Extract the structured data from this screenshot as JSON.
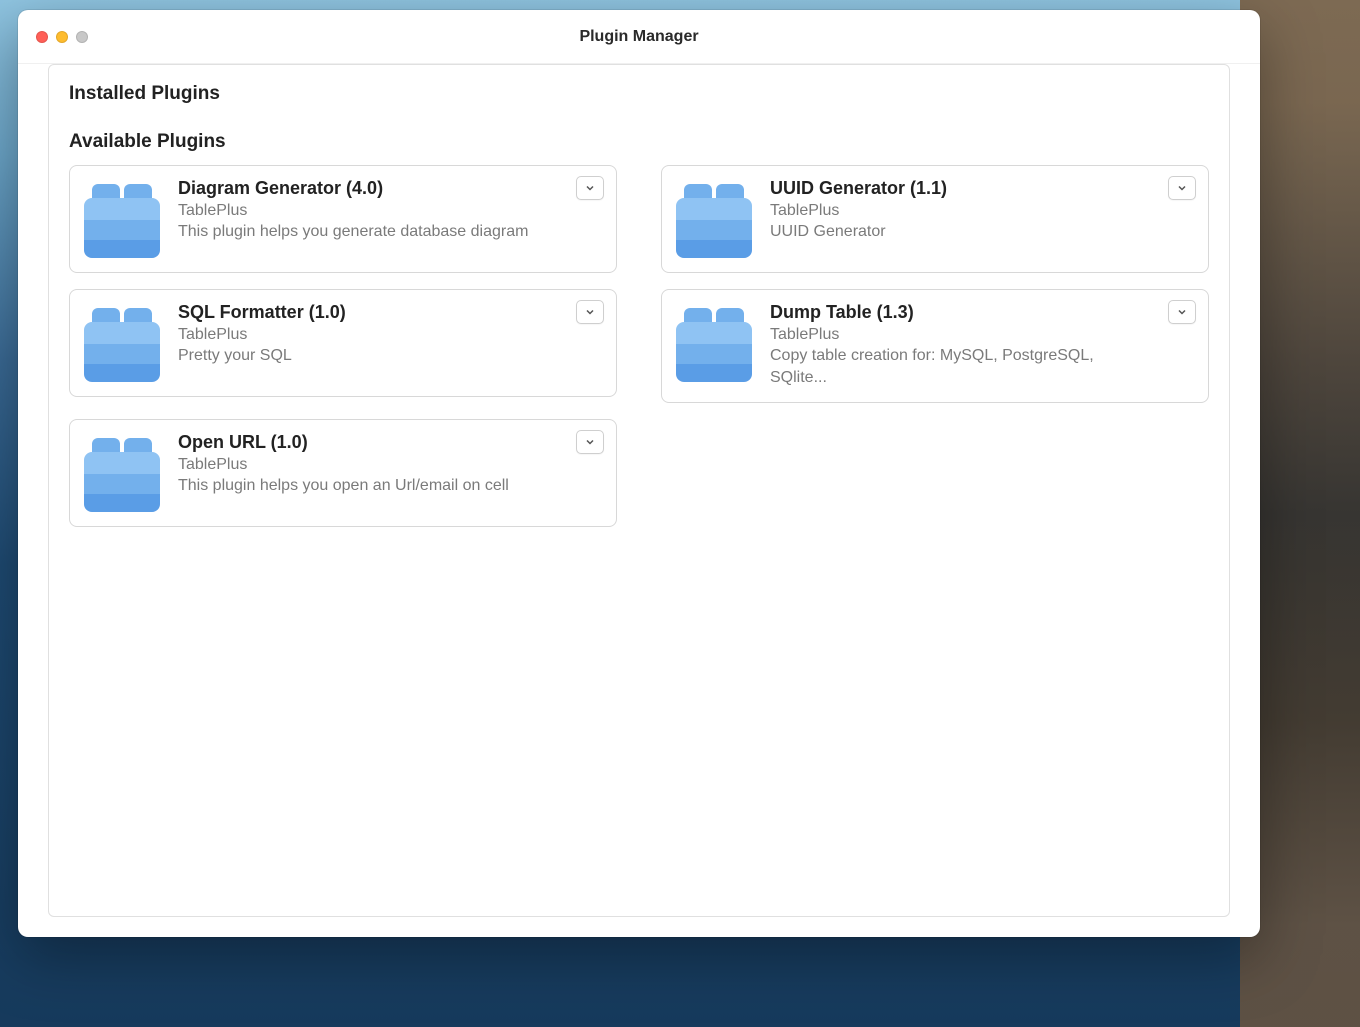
{
  "window": {
    "title": "Plugin Manager"
  },
  "sections": {
    "installed_heading": "Installed Plugins",
    "available_heading": "Available Plugins"
  },
  "plugins": {
    "diagram_generator": {
      "title": "Diagram Generator (4.0)",
      "author": "TablePlus",
      "description": "This plugin helps you generate database diagram"
    },
    "uuid_generator": {
      "title": "UUID Generator (1.1)",
      "author": "TablePlus",
      "description": "UUID Generator"
    },
    "sql_formatter": {
      "title": "SQL Formatter (1.0)",
      "author": "TablePlus",
      "description": "Pretty your SQL"
    },
    "dump_table": {
      "title": "Dump Table (1.3)",
      "author": "TablePlus",
      "description": "Copy table creation for: MySQL, PostgreSQL, SQlite..."
    },
    "open_url": {
      "title": "Open URL (1.0)",
      "author": "TablePlus",
      "description": "This plugin helps you open an Url/email on cell"
    }
  }
}
